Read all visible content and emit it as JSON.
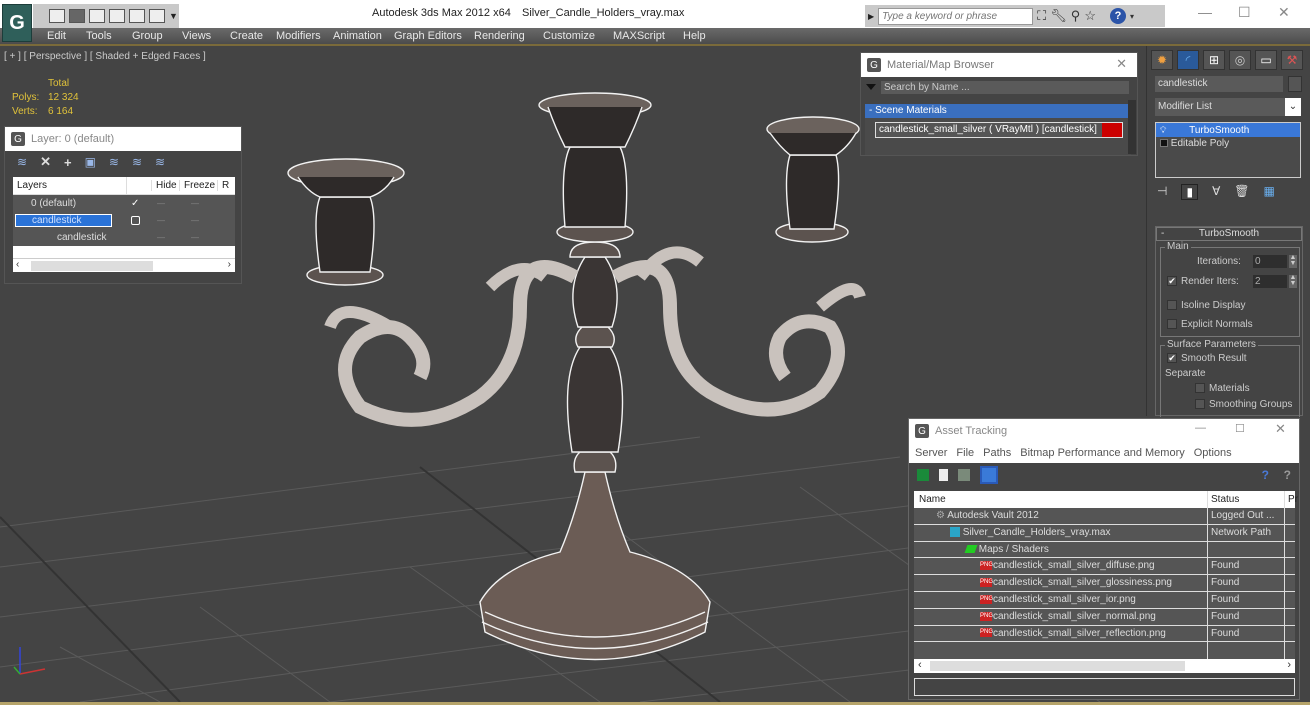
{
  "titlebar": {
    "app_logo": "G",
    "app_title": "Autodesk 3ds Max  2012 x64",
    "file_title": "Silver_Candle_Holders_vray.max",
    "search_placeholder": "Type a keyword or phrase",
    "help_label": "?",
    "icons": [
      "open-icon",
      "save-icon",
      "undo-icon",
      "project-icon",
      "redo-icon",
      "hold-icon"
    ],
    "right_icons": [
      "binoculars-icon",
      "wrench-icon",
      "satellite-icon",
      "star-icon"
    ],
    "minimize": "—",
    "maximize": "☐",
    "close": "✕"
  },
  "menubar": {
    "items": [
      "Edit",
      "Tools",
      "Group",
      "Views",
      "Create",
      "Modifiers",
      "Animation",
      "Graph Editors",
      "Rendering",
      "Customize",
      "MAXScript",
      "Help"
    ]
  },
  "viewport": {
    "label": "[ + ] [ Perspective ] [ Shaded + Edged Faces ]",
    "stats": {
      "header": "Total",
      "polys_label": "Polys:",
      "polys_value": "12 324",
      "verts_label": "Verts:",
      "verts_value": "6 164"
    }
  },
  "layer_panel": {
    "title": "Layer: 0 (default)",
    "help": "?",
    "close": "✕",
    "toolbar": [
      "create-layer",
      "delete",
      "add",
      "select",
      "select-highlighted",
      "hide-all",
      "freeze-all"
    ],
    "columns": [
      "Layers",
      "",
      "Hide",
      "Freeze",
      "R"
    ],
    "rows": [
      {
        "name": "0 (default)",
        "active_mark": "✓",
        "hide": "—",
        "freeze": "—"
      },
      {
        "name": "candlestick",
        "active_mark": "",
        "hide": "—",
        "freeze": "—"
      },
      {
        "name": "candlestick",
        "active_mark": "",
        "hide": "—",
        "freeze": "—"
      }
    ]
  },
  "material_browser": {
    "title": "Material/Map Browser",
    "close": "✕",
    "search_placeholder": "Search by Name ...",
    "group": "- Scene Materials",
    "item": "candlestick_small_silver ( VRayMtl ) [candlestick]",
    "swatch_color": "#cc0000"
  },
  "command_panel": {
    "object_name": "candlestick",
    "modifier_list": "Modifier List",
    "stack": [
      "TurboSmooth",
      "Editable Poly"
    ],
    "rollout": {
      "title": "TurboSmooth",
      "main_group": "Main",
      "iterations_label": "Iterations:",
      "iterations_value": "0",
      "render_iters_label": "Render Iters:",
      "render_iters_value": "2",
      "render_iters_checked": true,
      "isoline_display": "Isoline Display",
      "explicit_normals": "Explicit Normals",
      "surface_group": "Surface Parameters",
      "smooth_result": "Smooth Result",
      "smooth_result_checked": true,
      "separate": "Separate",
      "materials": "Materials",
      "smoothing_groups": "Smoothing Groups"
    }
  },
  "asset_tracking": {
    "title": "Asset Tracking",
    "minimize": "—",
    "maximize": "☐",
    "close": "✕",
    "menu": [
      "Server",
      "File",
      "Paths",
      "Bitmap Performance and Memory",
      "Options"
    ],
    "columns": [
      "Name",
      "Status",
      "Pr"
    ],
    "rows": [
      {
        "name": "Autodesk Vault 2012",
        "status": "Logged Out ...",
        "icon": "vault-icon",
        "indent": 1
      },
      {
        "name": "Silver_Candle_Holders_vray.max",
        "status": "Network Path",
        "icon": "max-file-icon",
        "indent": 2
      },
      {
        "name": "Maps / Shaders",
        "status": "",
        "icon": "maps-icon",
        "indent": 3
      },
      {
        "name": "candlestick_small_silver_diffuse.png",
        "status": "Found",
        "icon": "png-icon",
        "indent": 4
      },
      {
        "name": "candlestick_small_silver_glossiness.png",
        "status": "Found",
        "icon": "png-icon",
        "indent": 4
      },
      {
        "name": "candlestick_small_silver_ior.png",
        "status": "Found",
        "icon": "png-icon",
        "indent": 4
      },
      {
        "name": "candlestick_small_silver_normal.png",
        "status": "Found",
        "icon": "png-icon",
        "indent": 4
      },
      {
        "name": "candlestick_small_silver_reflection.png",
        "status": "Found",
        "icon": "png-icon",
        "indent": 4
      }
    ],
    "png_label": "PNG"
  }
}
